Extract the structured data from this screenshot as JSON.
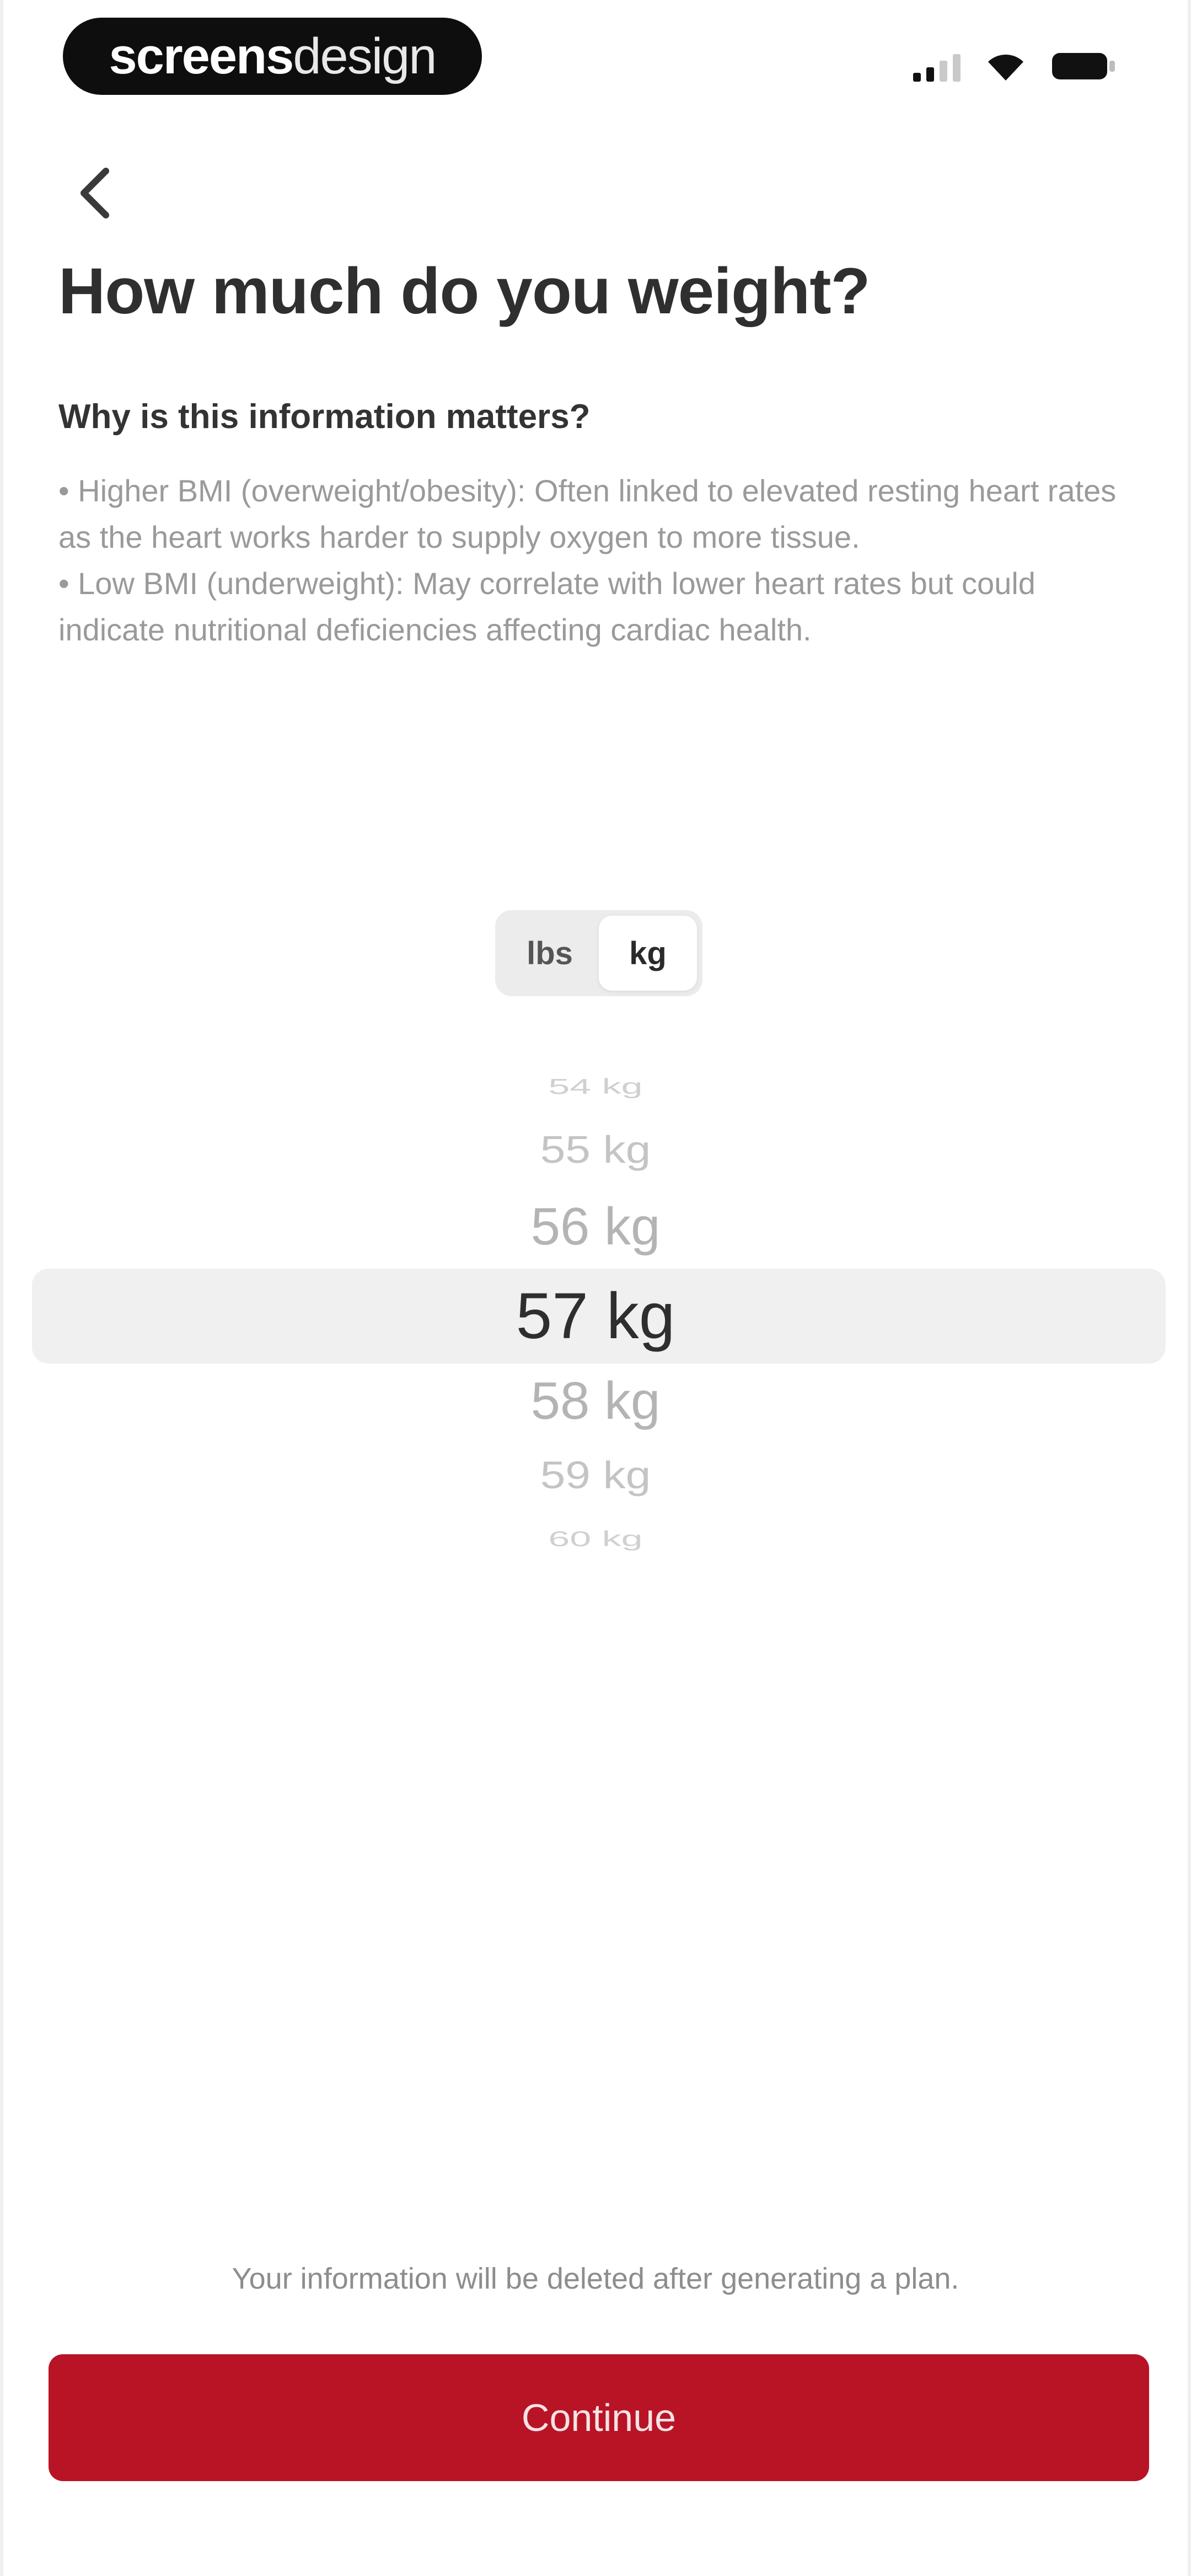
{
  "status_bar": {
    "brand_bold": "screens",
    "brand_light": "design",
    "signal_icon": "cellular-signal-icon",
    "wifi_icon": "wifi-icon",
    "battery_icon": "battery-icon"
  },
  "header": {
    "back_icon": "chevron-left-icon",
    "title": "How much do you weight?"
  },
  "info": {
    "heading": "Why is this information matters?",
    "points": [
      "• Higher BMI (overweight/obesity): Often linked to elevated resting heart rates as the heart works harder to supply oxygen to more tissue.",
      "• Low BMI (underweight): May correlate with lower heart rates but could indicate nutritional deficiencies affecting cardiac health."
    ]
  },
  "unit_toggle": {
    "options": [
      "lbs",
      "kg"
    ],
    "selected": "kg"
  },
  "picker": {
    "items": [
      "54 kg",
      "55 kg",
      "56 kg",
      "57 kg",
      "58 kg",
      "59 kg",
      "60 kg"
    ],
    "selected": "57 kg"
  },
  "footer": {
    "disclaimer": "Your information will be deleted after generating a plan.",
    "continue_label": "Continue"
  },
  "colors": {
    "primary": "#b81426",
    "highlight": "#f0f0f0",
    "toggle_bg": "#ececec"
  }
}
